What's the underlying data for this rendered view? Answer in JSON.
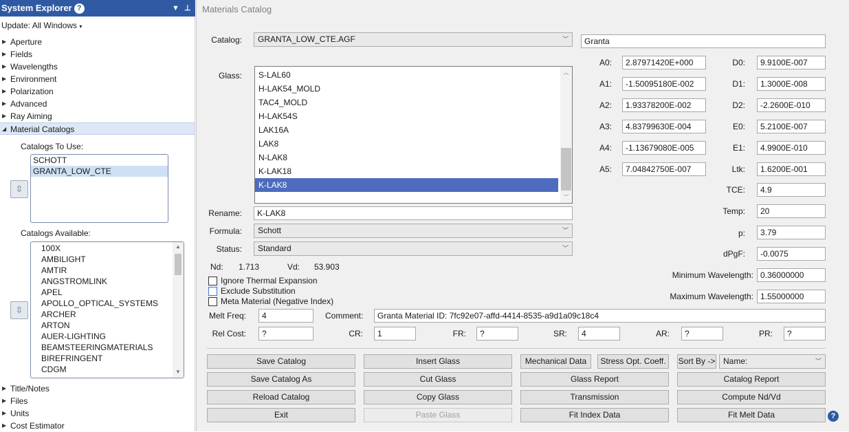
{
  "system_explorer": {
    "title": "System Explorer",
    "help_glyph": "?",
    "update_label": "Update: All Windows",
    "tree_top": [
      "Aperture",
      "Fields",
      "Wavelengths",
      "Environment",
      "Polarization",
      "Advanced",
      "Ray Aiming"
    ],
    "material_catalogs_label": "Material Catalogs",
    "catalogs_to_use_label": "Catalogs To Use:",
    "catalogs_to_use": [
      "SCHOTT",
      "GRANTA_LOW_CTE"
    ],
    "catalogs_available_label": "Catalogs Available:",
    "catalogs_available": [
      "100X",
      "AMBILIGHT",
      "AMTIR",
      "ANGSTROMLINK",
      "APEL",
      "APOLLO_OPTICAL_SYSTEMS",
      "ARCHER",
      "ARTON",
      "AUER-LIGHTING",
      "BEAMSTEERINGMATERIALS",
      "BIREFRINGENT",
      "CDGM"
    ],
    "tree_bottom": [
      "Title/Notes",
      "Files",
      "Units",
      "Cost Estimator"
    ]
  },
  "materials_catalog": {
    "title": "Materials Catalog",
    "catalog_label": "Catalog:",
    "catalog_value": "GRANTA_LOW_CTE.AGF",
    "catalog_note": "Granta",
    "glass_label": "Glass:",
    "glasses": [
      "S-LAL60",
      "H-LAK54_MOLD",
      "TAC4_MOLD",
      "H-LAK54S",
      "LAK16A",
      "LAK8",
      "N-LAK8",
      "K-LAK18",
      "K-LAK8"
    ],
    "selected_glass": "K-LAK8",
    "rename_label": "Rename:",
    "rename_value": "K-LAK8",
    "formula_label": "Formula:",
    "formula_value": "Schott",
    "status_label": "Status:",
    "status_value": "Standard",
    "nd_label": "Nd:",
    "nd_value": "1.713",
    "vd_label": "Vd:",
    "vd_value": "53.903",
    "checkboxes": {
      "ignore_thermal": "Ignore Thermal Expansion",
      "exclude_substitution": "Exclude Substitution",
      "meta_material": "Meta Material (Negative Index)"
    },
    "coefficients_a": [
      {
        "label": "A0:",
        "value": "2.87971420E+000"
      },
      {
        "label": "A1:",
        "value": "-1.50095180E-002"
      },
      {
        "label": "A2:",
        "value": "1.93378200E-002"
      },
      {
        "label": "A3:",
        "value": "4.83799630E-004"
      },
      {
        "label": "A4:",
        "value": "-1.13679080E-005"
      },
      {
        "label": "A5:",
        "value": "7.04842750E-007"
      }
    ],
    "coefficients_d": [
      {
        "label": "D0:",
        "value": "9.9100E-007"
      },
      {
        "label": "D1:",
        "value": "1.3000E-008"
      },
      {
        "label": "D2:",
        "value": "-2.2600E-010"
      },
      {
        "label": "E0:",
        "value": "5.2100E-007"
      },
      {
        "label": "E1:",
        "value": "4.9900E-010"
      },
      {
        "label": "Ltk:",
        "value": "1.6200E-001"
      }
    ],
    "tce_label": "TCE:",
    "tce_value": "4.9",
    "temp_label": "Temp:",
    "temp_value": "20",
    "p_label": "p:",
    "p_value": "3.79",
    "dpgf_label": "dPgF:",
    "dpgf_value": "-0.0075",
    "min_wl_label": "Minimum Wavelength:",
    "min_wl_value": "0.36000000",
    "max_wl_label": "Maximum Wavelength:",
    "max_wl_value": "1.55000000",
    "melt_freq_label": "Melt Freq:",
    "melt_freq_value": "4",
    "comment_label": "Comment:",
    "comment_value": "Granta Material ID: 7fc92e07-affd-4414-8535-a9d1a09c18c4",
    "rel_cost_label": "Rel Cost:",
    "rel_cost_value": "?",
    "cr_label": "CR:",
    "cr_value": "1",
    "fr_label": "FR:",
    "fr_value": "?",
    "sr_label": "SR:",
    "sr_value": "4",
    "ar_label": "AR:",
    "ar_value": "?",
    "pr_label": "PR:",
    "pr_value": "?",
    "buttons": {
      "save_catalog": "Save Catalog",
      "insert_glass": "Insert Glass",
      "mechanical_data": "Mechanical Data",
      "stress_opt": "Stress Opt. Coeff.",
      "sort_by": "Sort By ->",
      "save_catalog_as": "Save Catalog As",
      "cut_glass": "Cut Glass",
      "glass_report": "Glass Report",
      "catalog_report": "Catalog Report",
      "reload_catalog": "Reload Catalog",
      "copy_glass": "Copy Glass",
      "transmission": "Transmission",
      "compute_nd_vd": "Compute Nd/Vd",
      "exit": "Exit",
      "paste_glass": "Paste Glass",
      "fit_index_data": "Fit Index Data",
      "fit_melt_data": "Fit Melt Data"
    },
    "sort_value": "Name:",
    "help_glyph": "?"
  }
}
